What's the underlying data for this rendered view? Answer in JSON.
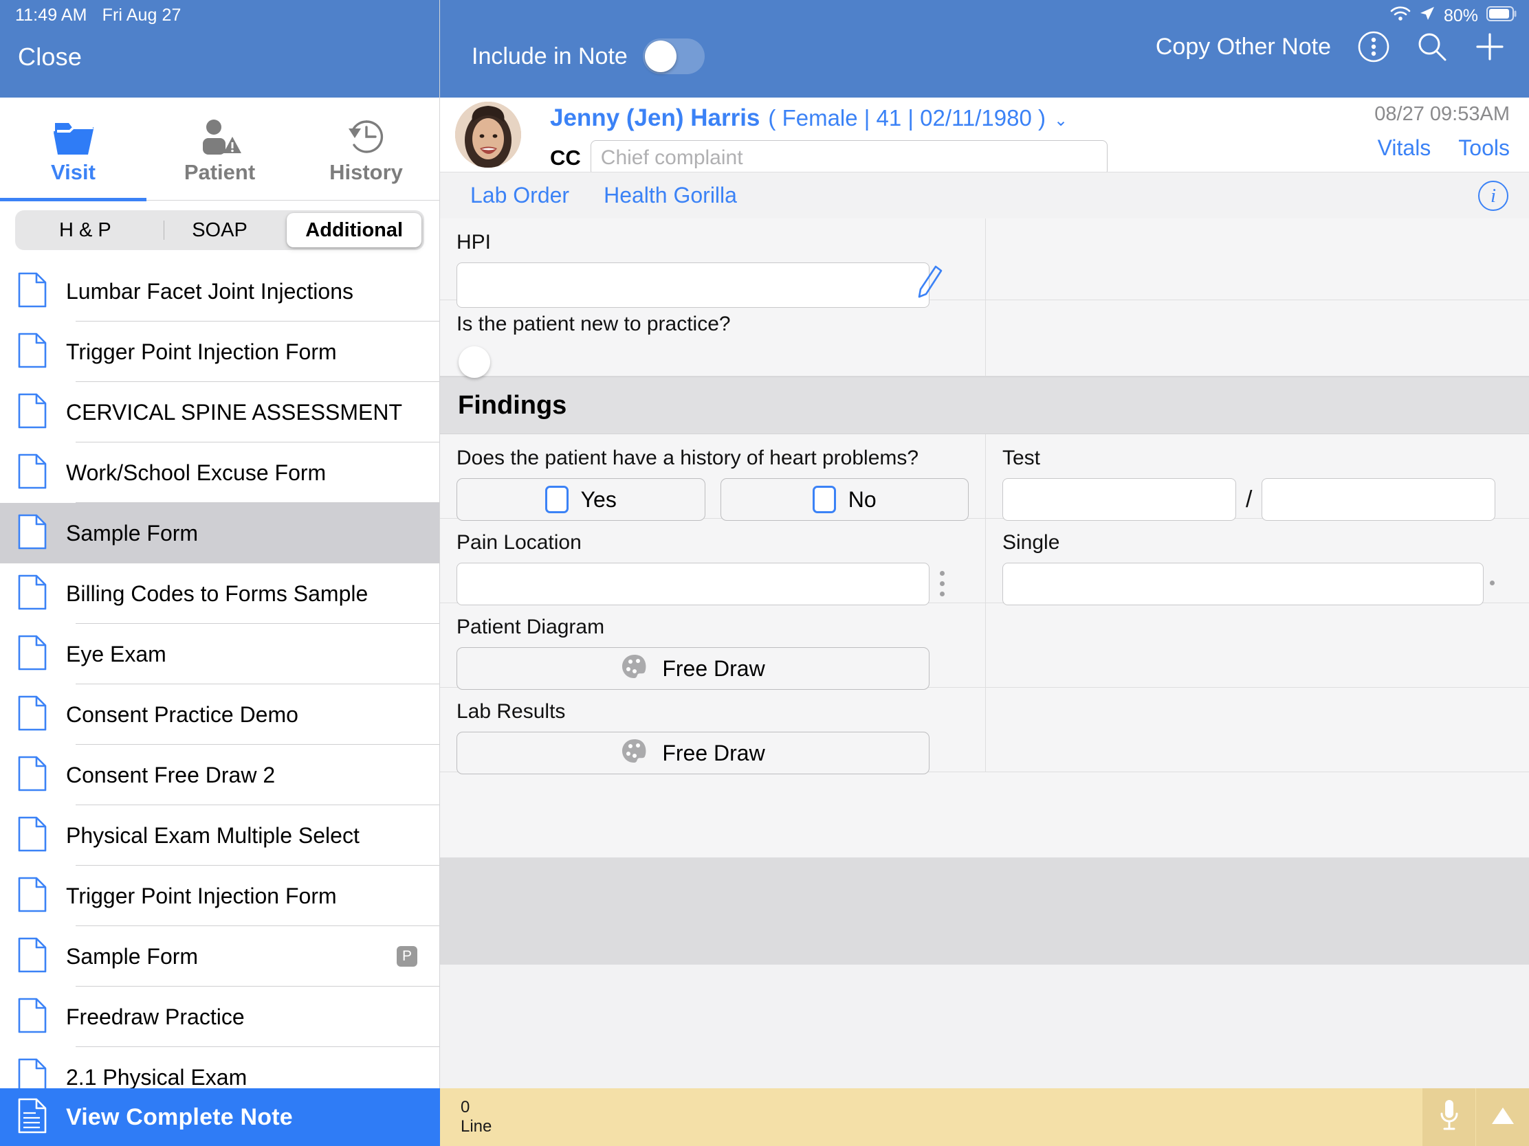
{
  "status_bar": {
    "time": "11:49 AM",
    "date": "Fri Aug 27",
    "battery_percent": "80%",
    "wifi_icon": "wifi-icon",
    "location_icon": "location-arrow-icon",
    "battery_icon": "battery-icon"
  },
  "sidebar": {
    "close_label": "Close",
    "tabs": [
      {
        "label": "Visit",
        "icon": "open-folder-icon",
        "active": true
      },
      {
        "label": "Patient",
        "icon": "person-warning-icon",
        "active": false
      },
      {
        "label": "History",
        "icon": "clock-history-icon",
        "active": false
      }
    ],
    "segments": [
      {
        "label": "H & P",
        "active": false
      },
      {
        "label": "SOAP",
        "active": false
      },
      {
        "label": "Additional",
        "active": true
      }
    ],
    "forms": [
      {
        "label": "Lumbar Facet Joint Injections",
        "selected": false,
        "badge": ""
      },
      {
        "label": "Trigger Point Injection Form",
        "selected": false,
        "badge": ""
      },
      {
        "label": "CERVICAL SPINE ASSESSMENT",
        "selected": false,
        "badge": ""
      },
      {
        "label": "Work/School Excuse Form",
        "selected": false,
        "badge": ""
      },
      {
        "label": "Sample Form",
        "selected": true,
        "badge": ""
      },
      {
        "label": "Billing Codes to Forms Sample",
        "selected": false,
        "badge": ""
      },
      {
        "label": "Eye Exam",
        "selected": false,
        "badge": ""
      },
      {
        "label": "Consent Practice Demo",
        "selected": false,
        "badge": ""
      },
      {
        "label": "Consent Free Draw 2",
        "selected": false,
        "badge": ""
      },
      {
        "label": "Physical Exam Multiple Select",
        "selected": false,
        "badge": ""
      },
      {
        "label": "Trigger Point Injection Form",
        "selected": false,
        "badge": ""
      },
      {
        "label": "Sample Form",
        "selected": false,
        "badge": "P"
      },
      {
        "label": "Freedraw Practice",
        "selected": false,
        "badge": ""
      },
      {
        "label": "2.1 Physical Exam",
        "selected": false,
        "badge": ""
      }
    ],
    "view_complete_note": "View Complete Note",
    "view_complete_note_icon": "document-lines-icon"
  },
  "topbar": {
    "include_in_note_label": "Include in Note",
    "include_in_note_on": false,
    "copy_other_note_label": "Copy Other Note",
    "more_icon": "three-dots-vertical-circle-icon",
    "search_icon": "search-icon",
    "add_icon": "plus-icon"
  },
  "patient_header": {
    "name": "Jenny (Jen) Harris",
    "demographics": "( Female | 41 | 02/11/1980 )",
    "chevron_icon": "chevron-down-icon",
    "cc_label": "CC",
    "cc_placeholder": "Chief complaint",
    "cc_value": "",
    "appointment_datetime": "08/27 09:53AM",
    "vitals_label": "Vitals",
    "tools_label": "Tools",
    "avatar_icon": "patient-photo-avatar"
  },
  "subbar": {
    "lab_order_label": "Lab Order",
    "health_gorilla_label": "Health Gorilla",
    "info_icon": "info-circle-icon"
  },
  "form": {
    "hpi": {
      "label": "HPI",
      "value": "",
      "pencil_icon": "pencil-icon"
    },
    "new_patient": {
      "label": "Is the patient new to practice?",
      "toggle_on": false
    },
    "findings_heading": "Findings",
    "heart_problems": {
      "label": "Does the patient have a history of heart problems?",
      "options": [
        {
          "label": "Yes",
          "checked": false
        },
        {
          "label": "No",
          "checked": false
        }
      ]
    },
    "test": {
      "label": "Test",
      "value_left": "",
      "separator": "/",
      "value_right": ""
    },
    "pain_location": {
      "label": "Pain Location",
      "value": "",
      "expand_icon": "vertical-dots-icon"
    },
    "single": {
      "label": "Single",
      "value": "",
      "expand_icon": "dot-icon"
    },
    "patient_diagram": {
      "label": "Patient Diagram",
      "button_label": "Free Draw",
      "icon": "palette-icon"
    },
    "lab_results": {
      "label": "Lab Results",
      "button_label": "Free Draw",
      "icon": "palette-icon"
    }
  },
  "bottom_bar": {
    "count": "0",
    "count_unit": "Line",
    "mic_icon": "microphone-icon",
    "expand_icon": "triangle-up-icon"
  },
  "colors": {
    "header_blue": "#4f81ca",
    "accent_blue": "#3b82f6",
    "selected_row": "#cfcfd3",
    "bottom_yellow": "#f4e0a8"
  }
}
